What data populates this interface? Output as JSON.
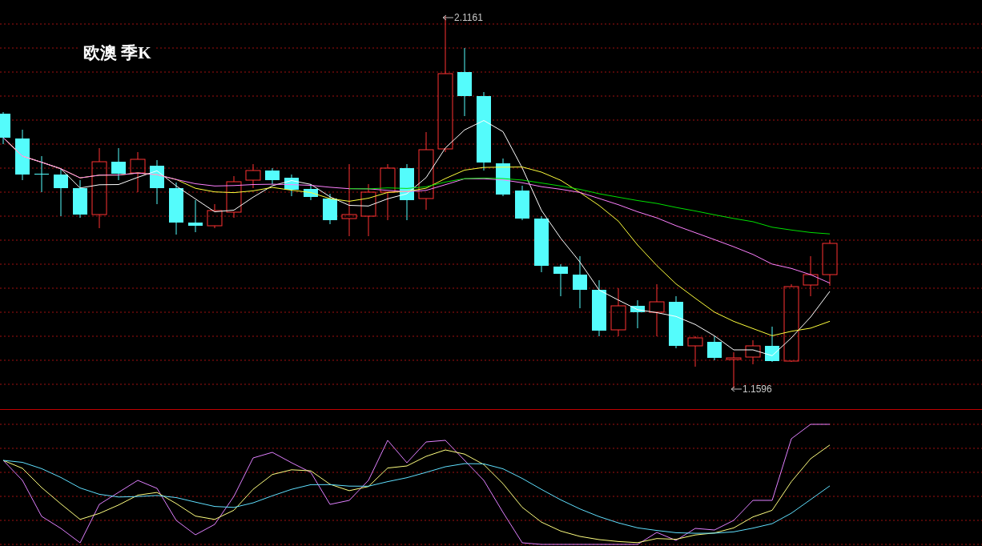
{
  "title": "欧澳 季K",
  "price_chart": {
    "high_label": "2.1161",
    "low_label": "1.1596"
  }
}
